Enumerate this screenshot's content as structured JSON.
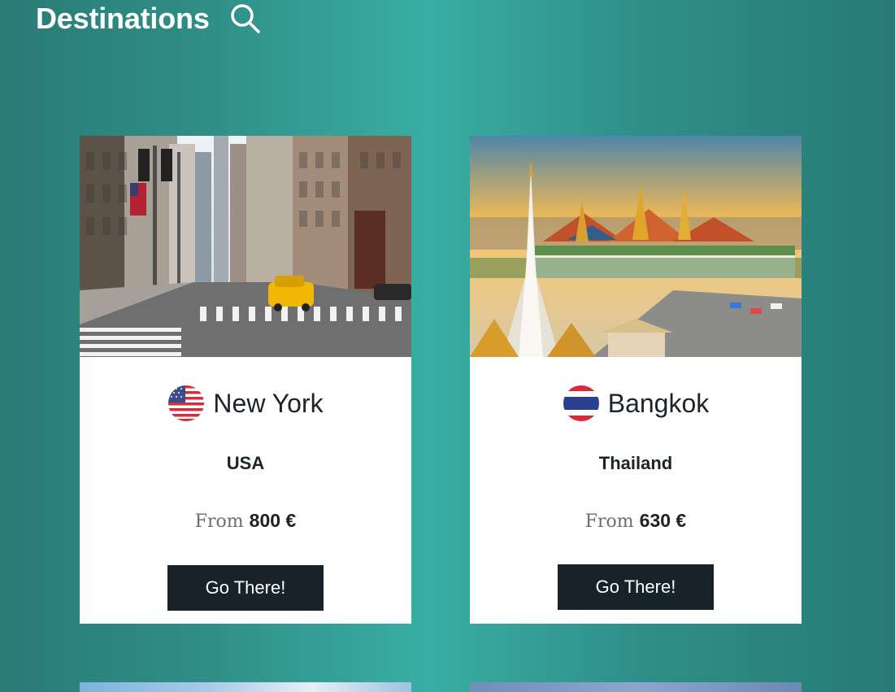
{
  "header": {
    "title": "Destinations",
    "search_icon": "search-icon"
  },
  "destinations": [
    {
      "city": "New York",
      "country": "USA",
      "price_prefix": "From",
      "price": "800 €",
      "button_label": "Go There!",
      "flag_icon": "usa-flag-icon"
    },
    {
      "city": "Bangkok",
      "country": "Thailand",
      "price_prefix": "From",
      "price": "630 €",
      "button_label": "Go There!",
      "flag_icon": "thailand-flag-icon"
    }
  ],
  "colors": {
    "background_dark": "#2a7b76",
    "background_light": "#39aea4",
    "button_bg": "#182329",
    "button_text": "#ffffff",
    "card_bg": "#ffffff"
  }
}
